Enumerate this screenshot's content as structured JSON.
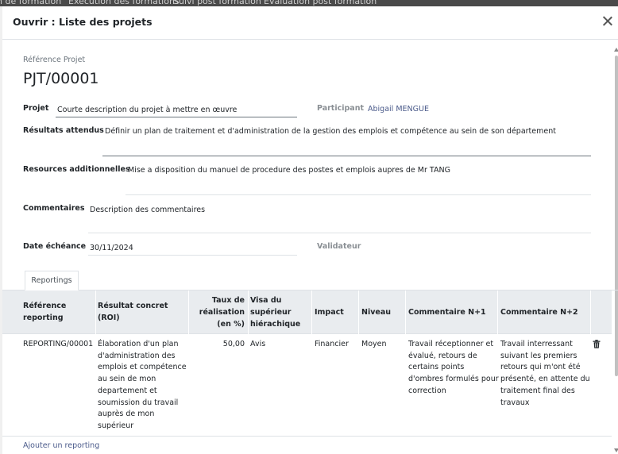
{
  "backdrop": {
    "nav": [
      "n de formation",
      "Execution des formations",
      "Suivi post formation",
      "Evaluation post formation"
    ]
  },
  "modal": {
    "title": "Ouvrir : Liste des projets"
  },
  "form": {
    "ref_label": "Référence Projet",
    "ref_value": "PJT/00001",
    "projet_label": "Projet",
    "projet_value": "Courte description du projet à mettre en œuvre",
    "participant_label": "Participant",
    "participant_value": "Abigail MENGUE",
    "resultats_label": "Résultats attendus",
    "resultats_value": "Définir un plan de traitement et d'administration de la gestion des emplois et compétence au sein de son département",
    "ressources_label": "Resources additionnelles",
    "ressources_value": "Mise a disposition du manuel de procedure des postes et emplois aupres de Mr TANG",
    "commentaires_label": "Commentaires",
    "commentaires_value": "Description des commentaires",
    "date_label": "Date échéance",
    "date_value": "30/11/2024",
    "validateur_label": "Validateur"
  },
  "tabs": {
    "reportings": "Reportings"
  },
  "table": {
    "headers": {
      "reference": [
        "Référence",
        "reporting"
      ],
      "resultat": [
        "Résultat concret",
        "(ROI)"
      ],
      "taux": [
        "Taux de",
        "réalisation",
        "(en %)"
      ],
      "visa": [
        "Visa du",
        "supérieur",
        "hiérachique"
      ],
      "impact": [
        "Impact"
      ],
      "niveau": [
        "Niveau"
      ],
      "comment1": [
        "Commentaire N+1"
      ],
      "comment2": [
        "Commentaire N+2"
      ]
    },
    "rows": [
      {
        "reference": "REPORTING/00001",
        "resultat": [
          "Élaboration d'un plan",
          "d'administration des",
          "emplois et compétence",
          "au sein de mon",
          "departement et",
          "soumission du travail",
          "auprès de mon",
          "supérieur"
        ],
        "taux": "50,00",
        "visa": "Avis",
        "impact": "Financier",
        "niveau": "Moyen",
        "comment1": [
          "Travail réceptionner et",
          "évalué, retours de",
          "certains points",
          "d'ombres formulés pour",
          "correction"
        ],
        "comment2": [
          "Travail interressant",
          "suivant les premiers",
          "retours qui m'ont été",
          "présenté, en attente du",
          "traitement final des",
          "travaux"
        ]
      }
    ],
    "add_label": "Ajouter un reporting"
  },
  "icons": {
    "close": "close-icon",
    "delete": "trash-icon"
  }
}
